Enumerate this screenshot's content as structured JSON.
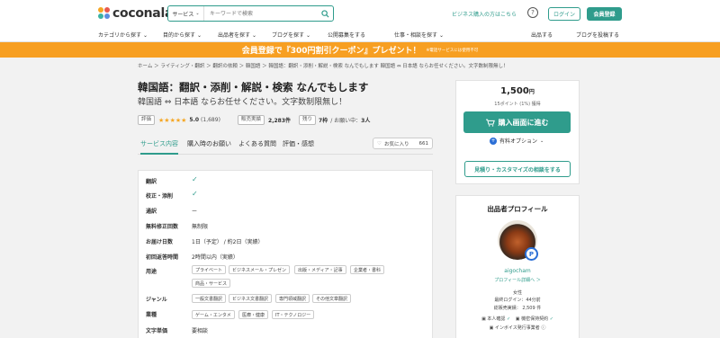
{
  "header": {
    "logo_text": "coconala",
    "search_category": "サービス",
    "search_placeholder": "キーワードで検索",
    "buyer_link": "ビジネス購入の方はこちら",
    "login": "ログイン",
    "register": "会員登録"
  },
  "nav": {
    "items": [
      "カテゴリから探す",
      "目的から探す",
      "出品者を探す",
      "ブログを探す",
      "公開募集をする",
      "仕事・相談を探す"
    ],
    "right_items": [
      "出品する",
      "ブログを投稿する"
    ]
  },
  "banner": {
    "text": "会員登録で『300円割引クーポン』プレゼント！",
    "note": "※電話サービスには使用不可"
  },
  "breadcrumb": "ホーム ＞ ライティング・翻訳 ＞ 翻訳の依頼 ＞ 韓国語 ＞ 韓国語：翻訳・添削・解説・検索 なんでもします 韓国語 ⇔ 日本語 ならお任せください。文字数制限無し！",
  "service": {
    "title": "韓国語：翻訳・添削・解説・検索 なんでもします",
    "subtitle": "韓国語 ⇔ 日本語 ならお任せください。文字数制限無し！",
    "rating_label": "評価",
    "stars": "★★★★★",
    "rating": "5.0",
    "review_count": "(1,689)",
    "sales_label": "販売実績",
    "sales": "2,283件",
    "remaining_label": "残り",
    "remaining": "7枠",
    "in_progress_label": "/ お願い中：",
    "in_progress": "3人"
  },
  "tabs": [
    "サービス内容",
    "購入時のお願い",
    "よくある質問",
    "評価・感想"
  ],
  "favorite": {
    "label": "お気に入り",
    "count": "661"
  },
  "details": {
    "rows": [
      {
        "label": "翻訳",
        "value": "✓"
      },
      {
        "label": "校正・添削",
        "value": "✓"
      },
      {
        "label": "通訳",
        "value": "ー"
      },
      {
        "label": "無料修正回数",
        "value": "無制限"
      },
      {
        "label": "お届け日数",
        "value": "1日（予定） / 約2日（実績）"
      },
      {
        "label": "初回返答時間",
        "value": "2時間以内（実績）"
      }
    ],
    "use_label": "用途",
    "use_chips": [
      "プライベート",
      "ビジネスメール・プレゼン",
      "出版・メディア・記事",
      "企業者・書科",
      "商品・サービス"
    ],
    "genre_label": "ジャンル",
    "genre_chips": [
      "一般文書翻訳",
      "ビジネス文書翻訳",
      "専門領域翻訳",
      "その他文章翻訳"
    ],
    "industry_label": "業種",
    "industry_chips": [
      "ゲーム・エンタメ",
      "医療・健康",
      "IT・テクノロジー"
    ],
    "text_units_label": "文字単価",
    "text_units_value": "要相談"
  },
  "purchase": {
    "price": "1,500",
    "price_unit": "円",
    "points": "15ポイント (1%) 獲得",
    "buy_button": "購入画面に進む",
    "paid_option": "有料オプション",
    "consult_button": "見積り・カスタマイズの相談をする"
  },
  "profile": {
    "title": "出品者プロフィール",
    "badge": "P",
    "name": "aigocham",
    "profile_link": "プロフィール詳細へ ＞",
    "gender": "女性",
    "last_login": "最終ログイン：44分前",
    "total_sales": "総販売実績： 2,509 件",
    "verified_id": "本人確認",
    "confidentiality": "機密保持契約",
    "invoice": "インボイス発行事業者"
  },
  "colors": {
    "accent": "#2f9c8c",
    "banner": "#f79f22",
    "star": "#f5a623"
  }
}
